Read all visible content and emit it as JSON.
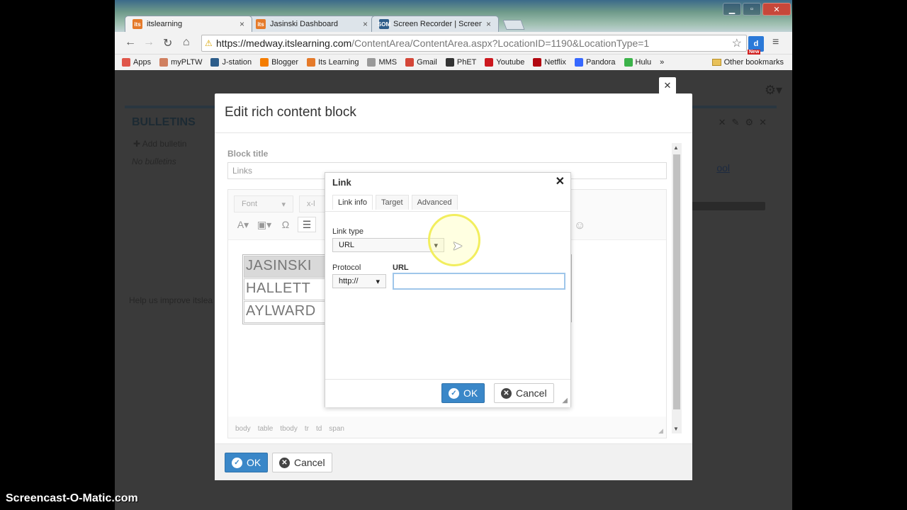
{
  "browser": {
    "tabs": [
      {
        "label": "itslearning",
        "favicon": "its",
        "active": true
      },
      {
        "label": "Jasinski Dashboard",
        "favicon": "its",
        "active": false
      },
      {
        "label": "Screen Recorder | Screenc",
        "favicon": "SOM",
        "active": false
      }
    ],
    "url_host": "https://medway.itslearning.com",
    "url_path": "/ContentArea/ContentArea.aspx?LocationID=1190&LocationType=1",
    "ext_label": "d",
    "ext_badge": "New",
    "bookmarks": [
      {
        "label": "Apps",
        "color": "#e0564a"
      },
      {
        "label": "myPLTW",
        "color": "#d08060"
      },
      {
        "label": "J-station",
        "color": "#2d5d8a"
      },
      {
        "label": "Blogger",
        "color": "#f57d00"
      },
      {
        "label": "Its Learning",
        "color": "#e57a2a"
      },
      {
        "label": "MMS",
        "color": "#999999"
      },
      {
        "label": "Gmail",
        "color": "#d44638"
      },
      {
        "label": "PhET",
        "color": "#333333"
      },
      {
        "label": "Youtube",
        "color": "#cc181e"
      },
      {
        "label": "Netflix",
        "color": "#b20710"
      },
      {
        "label": "Pandora",
        "color": "#3668ff"
      },
      {
        "label": "Hulu",
        "color": "#3cb34a"
      }
    ],
    "bookmarks_more": "»",
    "other_bookmarks": "Other bookmarks"
  },
  "page": {
    "bulletins_title": "BULLETINS",
    "add_bulletin": "Add bulletin",
    "no_bulletins": "No bulletins",
    "help_text": "Help us improve itslea",
    "right_link": "ool"
  },
  "modal": {
    "title": "Edit rich content block",
    "block_title_label": "Block title",
    "block_title_value": "Links",
    "font_dropdown": "Font",
    "size_dropdown": "x-l",
    "table_cells": [
      "JASINSKI",
      "HALLETT",
      "AYLWARD"
    ],
    "path": [
      "body",
      "table",
      "tbody",
      "tr",
      "td",
      "span"
    ],
    "ok_label": "OK",
    "cancel_label": "Cancel"
  },
  "link_dialog": {
    "title": "Link",
    "tabs": [
      "Link info",
      "Target",
      "Advanced"
    ],
    "link_type_label": "Link type",
    "link_type_value": "URL",
    "protocol_label": "Protocol",
    "protocol_value": "http://",
    "url_label": "URL",
    "url_value": "",
    "ok_label": "OK",
    "cancel_label": "Cancel"
  },
  "watermark": "Screencast-O-Matic.com"
}
